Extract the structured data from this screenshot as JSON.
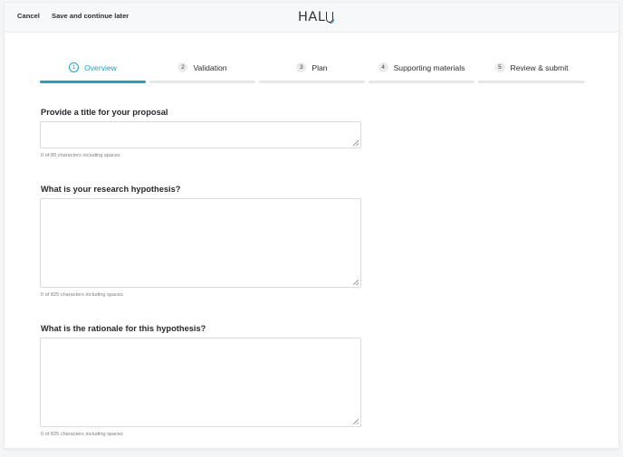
{
  "header": {
    "cancel_label": "Cancel",
    "save_label": "Save and continue later",
    "logo_text": "HAL"
  },
  "steps": [
    {
      "number": "1",
      "label": "Overview",
      "active": true
    },
    {
      "number": "2",
      "label": "Validation",
      "active": false
    },
    {
      "number": "3",
      "label": "Plan",
      "active": false
    },
    {
      "number": "4",
      "label": "Supporting materials",
      "active": false
    },
    {
      "number": "5",
      "label": "Review & submit",
      "active": false
    }
  ],
  "form": {
    "title": {
      "label": "Provide a title for your proposal",
      "value": "",
      "counter": "0 of 80 characters including spaces"
    },
    "hypothesis": {
      "label": "What is your research hypothesis?",
      "value": "",
      "counter": "0 of 825 characters including spaces"
    },
    "rationale": {
      "label": "What is the rationale for this hypothesis?",
      "value": "",
      "counter": "0 of 825 characters including spaces"
    }
  },
  "colors": {
    "accent": "#1aa3c9",
    "inactive_bar": "#e5e7ea"
  }
}
